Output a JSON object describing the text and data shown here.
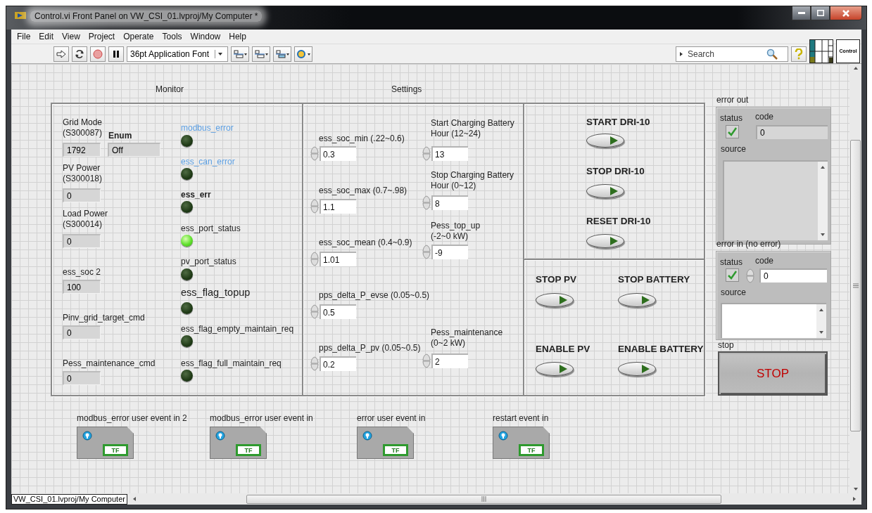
{
  "window": {
    "title": "Control.vi Front Panel on VW_CSI_01.lvproj/My Computer *"
  },
  "menu": [
    "File",
    "Edit",
    "View",
    "Project",
    "Operate",
    "Tools",
    "Window",
    "Help"
  ],
  "toolbar": {
    "font": "36pt Application Font",
    "search": {
      "placeholder": "Search"
    },
    "vi_icon_text": "Control"
  },
  "section_labels": [
    "Monitor",
    "Settings"
  ],
  "monitor": {
    "indicators": [
      {
        "label": "Grid Mode\n(S300087)",
        "value": "1792"
      },
      {
        "label": "PV Power\n(S300018)",
        "value": "0"
      },
      {
        "label": "Load Power\n(S300014)",
        "value": "0"
      },
      {
        "label": "ess_soc 2",
        "value": "100"
      },
      {
        "label": "Pinv_grid_target_cmd",
        "value": "0"
      },
      {
        "label": "Pess_maintenance_cmd",
        "value": "0"
      }
    ],
    "enum": {
      "label": "Enum",
      "value": "Off"
    },
    "leds": [
      {
        "label": "modbus_error",
        "kind": "blue",
        "on": false
      },
      {
        "label": "ess_can_error",
        "kind": "blue",
        "on": false
      },
      {
        "label": "ess_err",
        "kind": "bold",
        "on": false
      },
      {
        "label": "ess_port_status",
        "kind": "plain",
        "on": true
      },
      {
        "label": "pv_port_status",
        "kind": "plain",
        "on": false
      },
      {
        "label": "ess_flag_topup",
        "kind": "large",
        "on": false
      },
      {
        "label": "ess_flag_empty_maintain_req",
        "kind": "plain",
        "on": false
      },
      {
        "label": "ess_flag_full_maintain_req",
        "kind": "plain",
        "on": false
      }
    ]
  },
  "settings": {
    "left": [
      {
        "label": "ess_soc_min (.22~0.6)",
        "value": "0.3"
      },
      {
        "label": "ess_soc_max (0.7~.98)",
        "value": "1.1"
      },
      {
        "label": "ess_soc_mean (0.4~0.9)",
        "value": "1.01"
      },
      {
        "label": "pps_delta_P_evse (0.05~0.5)",
        "value": "0.5"
      },
      {
        "label": "pps_delta_P_pv (0.05~0.5)",
        "value": "0.2"
      }
    ],
    "right": [
      {
        "label": "Start Charging Battery\nHour (12~24)",
        "value": "13"
      },
      {
        "label": "Stop Charging Battery\nHour (0~12)",
        "value": "8"
      },
      {
        "label": "Pess_top_up\n(-2~0 kW)",
        "value": "-9"
      },
      {
        "label": "Pess_maintenance\n(0~2 kW)",
        "value": "2"
      }
    ]
  },
  "commands": {
    "drive": [
      "START DRI-10",
      "STOP DRI-10",
      "RESET DRI-10"
    ],
    "power": [
      "STOP PV",
      "STOP BATTERY",
      "ENABLE PV",
      "ENABLE BATTERY"
    ]
  },
  "error_out": {
    "label": "error out",
    "status_label": "status",
    "code_label": "code",
    "checked": true,
    "code": "0",
    "source_label": "source"
  },
  "error_in": {
    "label": "error in (no error)",
    "status_label": "status",
    "code_label": "code",
    "checked": true,
    "code": "0",
    "source_label": "source"
  },
  "stop": {
    "label": "stop",
    "button": "STOP"
  },
  "event_refs": [
    {
      "label": "modbus_error user event in 2",
      "type_text": "TF"
    },
    {
      "label": "modbus_error user event in",
      "type_text": "TF"
    },
    {
      "label": "error user event in",
      "type_text": "TF"
    },
    {
      "label": "restart event in",
      "type_text": "TF"
    }
  ],
  "status_bar": {
    "context": "VW_CSI_01.lvproj/My Computer"
  }
}
